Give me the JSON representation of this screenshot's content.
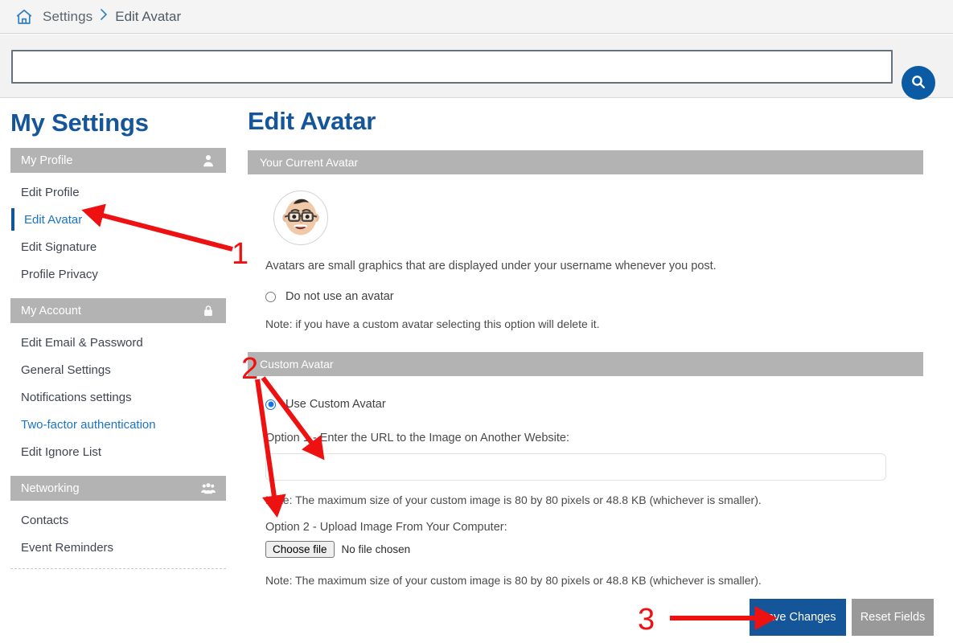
{
  "breadcrumb": {
    "home_icon": "home-icon",
    "root": "Settings",
    "separator": "›",
    "current": "Edit Avatar"
  },
  "search": {
    "value": "",
    "placeholder": "",
    "button_icon": "search-icon"
  },
  "sidebar": {
    "title": "My Settings",
    "groups": [
      {
        "label": "My Profile",
        "icon": "user-icon",
        "items": [
          {
            "label": "Edit Profile",
            "state": "normal"
          },
          {
            "label": "Edit Avatar",
            "state": "active"
          },
          {
            "label": "Edit Signature",
            "state": "normal"
          },
          {
            "label": "Profile Privacy",
            "state": "normal"
          }
        ]
      },
      {
        "label": "My Account",
        "icon": "lock-icon",
        "items": [
          {
            "label": "Edit Email & Password",
            "state": "normal"
          },
          {
            "label": "General Settings",
            "state": "normal"
          },
          {
            "label": "Notifications settings",
            "state": "normal"
          },
          {
            "label": "Two-factor authentication",
            "state": "link"
          },
          {
            "label": "Edit Ignore List",
            "state": "normal"
          }
        ]
      },
      {
        "label": "Networking",
        "icon": "group-icon",
        "items": [
          {
            "label": "Contacts",
            "state": "normal"
          },
          {
            "label": "Event Reminders",
            "state": "normal"
          }
        ]
      }
    ]
  },
  "main": {
    "title": "Edit Avatar",
    "current_avatar_panel": {
      "header": "Your Current Avatar",
      "avatar_icon": "memoji-avatar",
      "description": "Avatars are small graphics that are displayed under your username whenever you post.",
      "no_avatar_option": {
        "label": "Do not use an avatar",
        "checked": false
      },
      "note": "Note: if you have a custom avatar selecting this option will delete it."
    },
    "custom_avatar_panel": {
      "header": "Custom Avatar",
      "use_custom_option": {
        "label": "Use Custom Avatar",
        "checked": true
      },
      "option1_label": "Option 1 - Enter the URL to the Image on Another Website:",
      "option1_value": "",
      "option1_placeholder": "",
      "option1_note": "Note: The maximum size of your custom image is 80 by 80 pixels or 48.8 KB (whichever is smaller).",
      "option2_label": "Option 2 - Upload Image From Your Computer:",
      "file_button_label": "Choose file",
      "file_status": "No file chosen",
      "option2_note": "Note: The maximum size of your custom image is 80 by 80 pixels or 48.8 KB (whichever is smaller)."
    }
  },
  "actions": {
    "save_label": "Save Changes",
    "reset_label": "Reset Fields"
  },
  "annotations": {
    "color": "#ee1111",
    "markers": [
      {
        "number": "1",
        "target": "sidebar-item-edit-avatar"
      },
      {
        "number": "2",
        "target": "custom-avatar-url-and-upload"
      },
      {
        "number": "3",
        "target": "save-changes-button"
      }
    ]
  },
  "colors": {
    "brand_blue": "#15559a",
    "link_blue": "#1a73c7",
    "panel_gray": "#b3b3b3",
    "button_gray": "#999999",
    "annotation_red": "#ee1111"
  }
}
